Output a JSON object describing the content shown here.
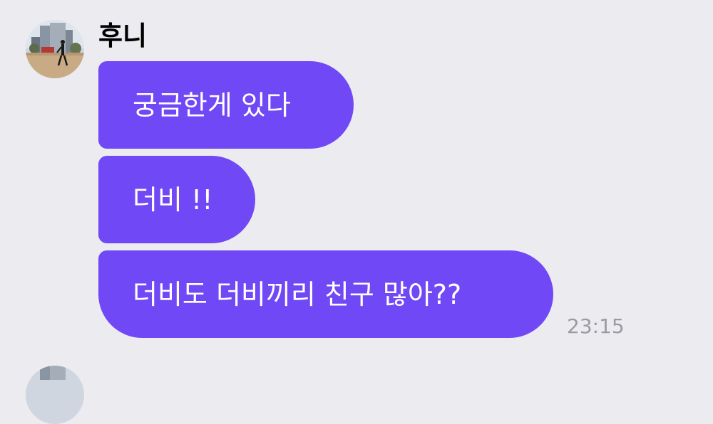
{
  "message_group": {
    "sender": {
      "name": "후니",
      "avatar": "profile-photo"
    },
    "messages": [
      {
        "text": "궁금한게 있다"
      },
      {
        "text": "더비 !!"
      },
      {
        "text": "더비도 더비끼리 친구 많아??"
      }
    ],
    "time": "23:15"
  },
  "colors": {
    "background": "#ebebf0",
    "bubble": "#7048f5",
    "bubble_text": "#ffffff",
    "timestamp": "#9a9aa0"
  }
}
